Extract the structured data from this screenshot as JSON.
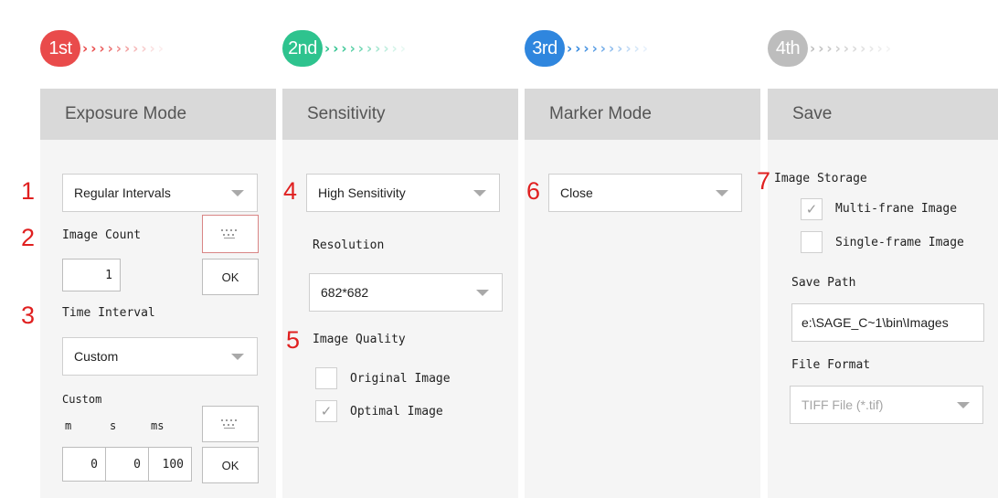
{
  "steps": [
    {
      "badge": "1st",
      "color": "#e94b4b"
    },
    {
      "badge": "2nd",
      "color": "#2ec38e"
    },
    {
      "badge": "3rd",
      "color": "#2f86de"
    },
    {
      "badge": "4th",
      "color": "#bdbdbd"
    }
  ],
  "chevrons": "›",
  "panels": {
    "exposure": {
      "title": "Exposure Mode",
      "mode_dropdown": "Regular Intervals",
      "image_count_label": "Image Count",
      "image_count_value": "1",
      "ok_label": "OK",
      "time_interval_label": "Time Interval",
      "time_interval_dropdown": "Custom",
      "custom_label": "Custom",
      "unit_m": "m",
      "unit_s": "s",
      "unit_ms": "ms",
      "custom_m": "0",
      "custom_s": "0",
      "custom_ms": "100",
      "ok2_label": "OK"
    },
    "sensitivity": {
      "title": "Sensitivity",
      "sensitivity_dropdown": "High Sensitivity",
      "resolution_label": "Resolution",
      "resolution_dropdown": "682*682",
      "image_quality_label": "Image Quality",
      "original_image": "Original Image",
      "optimal_image": "Optimal Image",
      "optimal_checked": true
    },
    "marker": {
      "title": "Marker Mode",
      "marker_dropdown": "Close"
    },
    "save": {
      "title": "Save",
      "image_storage_label": "Image Storage",
      "multi_frame": "Multi-frane Image",
      "single_frame": "Single-frame Image",
      "save_path_label": "Save Path",
      "save_path_value": "e:\\SAGE_C~1\\bin\\Images",
      "file_format_label": "File Format",
      "file_format_dropdown": "TIFF File (*.tif)"
    }
  },
  "annotations": {
    "n1": "1",
    "n2": "2",
    "n3": "3",
    "n4": "4",
    "n5": "5",
    "n6": "6",
    "n7": "7"
  },
  "icons": {
    "check": "✓",
    "keyboard": "keyboard-icon",
    "caret": "caret-down-icon"
  }
}
